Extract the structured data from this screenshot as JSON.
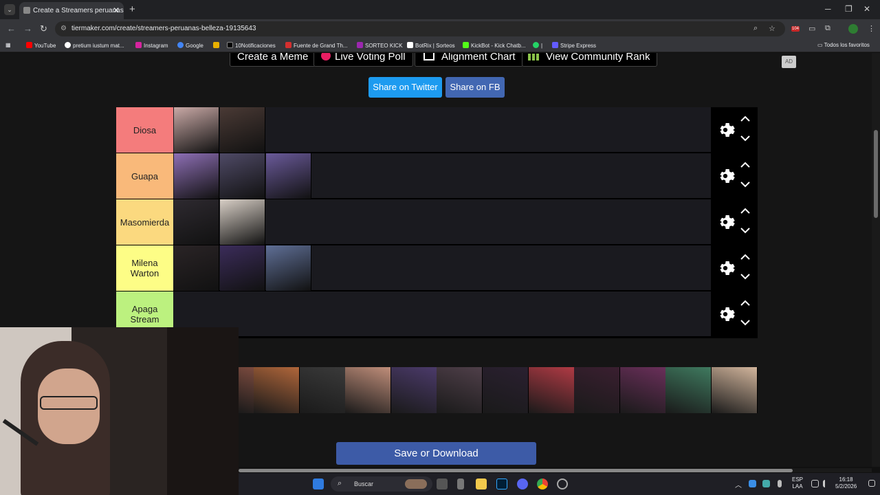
{
  "browser": {
    "tab_title": "Create a Streamers peruanas b...",
    "tab_close": "✕",
    "new_tab": "+",
    "url": "tiermaker.com/create/streamers-peruanas-belleza-19135643",
    "bookmarks": [
      {
        "label": "YouTube",
        "color": "#ff0000"
      },
      {
        "label": "pretium iustum mat...",
        "color": "#ffffff"
      },
      {
        "label": "Instagram",
        "color": "#d6249f"
      },
      {
        "label": "Google",
        "color": "#4285f4"
      },
      {
        "label": "",
        "color": "#e8b000"
      },
      {
        "label": "10Notificaciones",
        "color": "#000000"
      },
      {
        "label": "Fuente de Grand Th...",
        "color": "#d32f2f"
      },
      {
        "label": "SORTEO KICK",
        "color": "#9c27b0"
      },
      {
        "label": "BotRix | Sorteos",
        "color": "#ffffff"
      },
      {
        "label": "KickBot - Kick Chatb...",
        "color": "#53fc18"
      },
      {
        "label": "|",
        "color": "#25d366"
      },
      {
        "label": "Stripe Express",
        "color": "#635bff"
      }
    ],
    "all_bookmarks": "Todos los favoritos"
  },
  "page": {
    "top_buttons": [
      "Create a Meme",
      "Live Voting Poll",
      "Alignment Chart",
      "View Community Rank"
    ],
    "ad_badge": "AD",
    "share_twitter": "Share on Twitter",
    "share_fb": "Share on FB",
    "save_button": "Save or Download"
  },
  "tiers": [
    {
      "label": "Diosa",
      "color": "#f47c7c",
      "items": [
        {
          "color": "#c9a9a6"
        },
        {
          "color": "#4a3a35"
        }
      ]
    },
    {
      "label": "Guapa",
      "color": "#f9b97a",
      "items": [
        {
          "color": "#8e6fb5"
        },
        {
          "color": "#4f4a66"
        },
        {
          "color": "#6a5a9a"
        }
      ]
    },
    {
      "label": "Masomierda",
      "color": "#fbd97f",
      "items": [
        {
          "color": "#2e2a30"
        },
        {
          "color": "#d8cfc6"
        }
      ]
    },
    {
      "label": "Milena Warton",
      "color": "#fdfd86",
      "items": [
        {
          "color": "#2a2426"
        },
        {
          "color": "#3b2c5a"
        },
        {
          "color": "#5f6f96"
        }
      ]
    },
    {
      "label": "Apaga Stream",
      "color": "#bcf17f",
      "items": []
    }
  ],
  "pool": [
    {
      "color": "#7a4a3e"
    },
    {
      "color": "#b0663a"
    },
    {
      "color": "#3a3a3a"
    },
    {
      "color": "#c08e7a"
    },
    {
      "color": "#4b3a6a"
    },
    {
      "color": "#4f3f49"
    },
    {
      "color": "#2a2030"
    },
    {
      "color": "#b03a44"
    },
    {
      "color": "#3a1f30"
    },
    {
      "color": "#6a2f5a"
    },
    {
      "color": "#3f7a5f"
    },
    {
      "color": "#d2b59c"
    }
  ],
  "taskbar": {
    "search_placeholder": "Buscar",
    "lang_top": "ESP",
    "lang_bottom": "LAA",
    "time": "16:18",
    "date": "5/2/2026",
    "badge_count": "104"
  }
}
